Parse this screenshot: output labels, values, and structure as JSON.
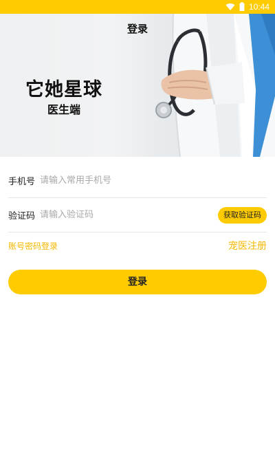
{
  "status_bar": {
    "time": "10:44",
    "wifi_icon": "wifi-icon",
    "battery_icon": "battery-icon",
    "background": "#FECB00"
  },
  "header": {
    "title": "登录"
  },
  "hero": {
    "app_name": "它她星球",
    "subtitle": "医生端"
  },
  "form": {
    "phone": {
      "label": "手机号",
      "placeholder": "请输入常用手机号",
      "value": ""
    },
    "code": {
      "label": "验证码",
      "placeholder": "请输入验证码",
      "value": "",
      "button_label": "获取验证码"
    }
  },
  "links": {
    "password_login": "账号密码登录",
    "register": "宠医注册"
  },
  "login_button": {
    "label": "登录"
  },
  "colors": {
    "accent": "#FECB00",
    "link": "#F5B800"
  }
}
